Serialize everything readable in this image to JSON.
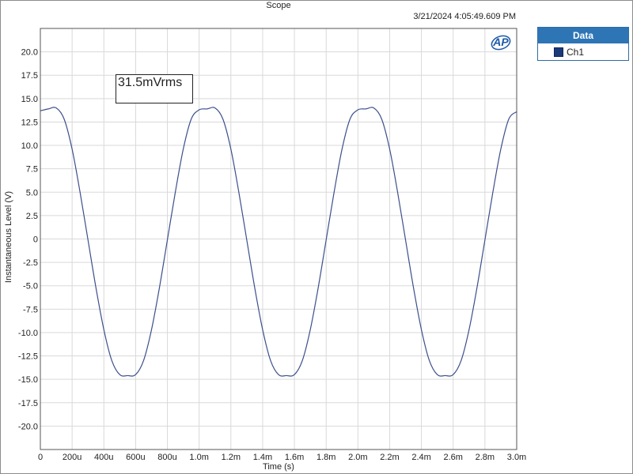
{
  "window": {
    "title": "Scope",
    "timestamp": "3/21/2024 4:05:49.609 PM"
  },
  "legend": {
    "header": "Data",
    "items": [
      {
        "label": "Ch1",
        "color": "#1a3a7a"
      }
    ]
  },
  "annotation": {
    "text": "31.5mVrms"
  },
  "logo": {
    "text": "AP",
    "color": "#1c5aa8"
  },
  "chart_data": {
    "type": "line",
    "xlabel": "Time (s)",
    "ylabel": "Instantaneous Level (V)",
    "xlim": [
      0,
      0.003
    ],
    "ylim": [
      -22.5,
      22.5
    ],
    "grid": true,
    "x_ticks": [
      {
        "value": 0,
        "label": "0"
      },
      {
        "value": 0.0002,
        "label": "200u"
      },
      {
        "value": 0.0004,
        "label": "400u"
      },
      {
        "value": 0.0006,
        "label": "600u"
      },
      {
        "value": 0.0008,
        "label": "800u"
      },
      {
        "value": 0.001,
        "label": "1.0m"
      },
      {
        "value": 0.0012,
        "label": "1.2m"
      },
      {
        "value": 0.0014,
        "label": "1.4m"
      },
      {
        "value": 0.0016,
        "label": "1.6m"
      },
      {
        "value": 0.0018,
        "label": "1.8m"
      },
      {
        "value": 0.002,
        "label": "2.0m"
      },
      {
        "value": 0.0022,
        "label": "2.2m"
      },
      {
        "value": 0.0024,
        "label": "2.4m"
      },
      {
        "value": 0.0026,
        "label": "2.6m"
      },
      {
        "value": 0.0028,
        "label": "2.8m"
      },
      {
        "value": 0.003,
        "label": "3.0m"
      }
    ],
    "y_ticks": [
      {
        "value": 20,
        "label": "20.0"
      },
      {
        "value": 17.5,
        "label": "17.5"
      },
      {
        "value": 15,
        "label": "15.0"
      },
      {
        "value": 12.5,
        "label": "12.5"
      },
      {
        "value": 10,
        "label": "10.0"
      },
      {
        "value": 7.5,
        "label": "7.5"
      },
      {
        "value": 5,
        "label": "5.0"
      },
      {
        "value": 2.5,
        "label": "2.5"
      },
      {
        "value": 0,
        "label": "0"
      },
      {
        "value": -2.5,
        "label": "-2.5"
      },
      {
        "value": -5,
        "label": "-5.0"
      },
      {
        "value": -7.5,
        "label": "-7.5"
      },
      {
        "value": -10,
        "label": "-10.0"
      },
      {
        "value": -12.5,
        "label": "-12.5"
      },
      {
        "value": -15,
        "label": "-15.0"
      },
      {
        "value": -17.5,
        "label": "-17.5"
      },
      {
        "value": -20,
        "label": "-20.0"
      }
    ],
    "series": [
      {
        "name": "Ch1",
        "color": "#3c4f8c",
        "x": [
          0,
          5e-05,
          0.0001,
          0.00015,
          0.0002,
          0.00025,
          0.0003,
          0.00035,
          0.0004,
          0.00045,
          0.0005,
          0.00055,
          0.0006,
          0.00065,
          0.0007,
          0.00075,
          0.0008,
          0.00085,
          0.0009,
          0.00095,
          0.001,
          0.00105,
          0.0011,
          0.00115,
          0.0012,
          0.00125,
          0.0013,
          0.00135,
          0.0014,
          0.00145,
          0.0015,
          0.00155,
          0.0016,
          0.00165,
          0.0017,
          0.00175,
          0.0018,
          0.00185,
          0.0019,
          0.00195,
          0.002,
          0.00205,
          0.0021,
          0.00215,
          0.0022,
          0.00225,
          0.0023,
          0.00235,
          0.0024,
          0.00245,
          0.0025,
          0.00255,
          0.0026,
          0.00265,
          0.0027,
          0.00275,
          0.0028,
          0.00285,
          0.0029,
          0.00295,
          0.003
        ],
        "y": [
          13.7,
          13.9,
          14.0,
          12.8,
          9.6,
          5.0,
          -0.1,
          -5.2,
          -9.7,
          -13.0,
          -14.5,
          -14.6,
          -14.5,
          -13.0,
          -9.7,
          -5.2,
          -0.1,
          5.0,
          9.6,
          12.8,
          13.8,
          13.9,
          14.0,
          12.8,
          9.6,
          5.0,
          -0.1,
          -5.2,
          -9.7,
          -13.0,
          -14.5,
          -14.6,
          -14.5,
          -13.0,
          -9.7,
          -5.2,
          -0.1,
          5.0,
          9.6,
          12.8,
          13.8,
          13.9,
          14.0,
          12.8,
          9.6,
          5.0,
          -0.1,
          -5.2,
          -9.7,
          -13.0,
          -14.5,
          -14.6,
          -14.5,
          -13.0,
          -9.7,
          -5.2,
          -0.1,
          5.0,
          9.6,
          12.8,
          13.6
        ]
      }
    ]
  }
}
